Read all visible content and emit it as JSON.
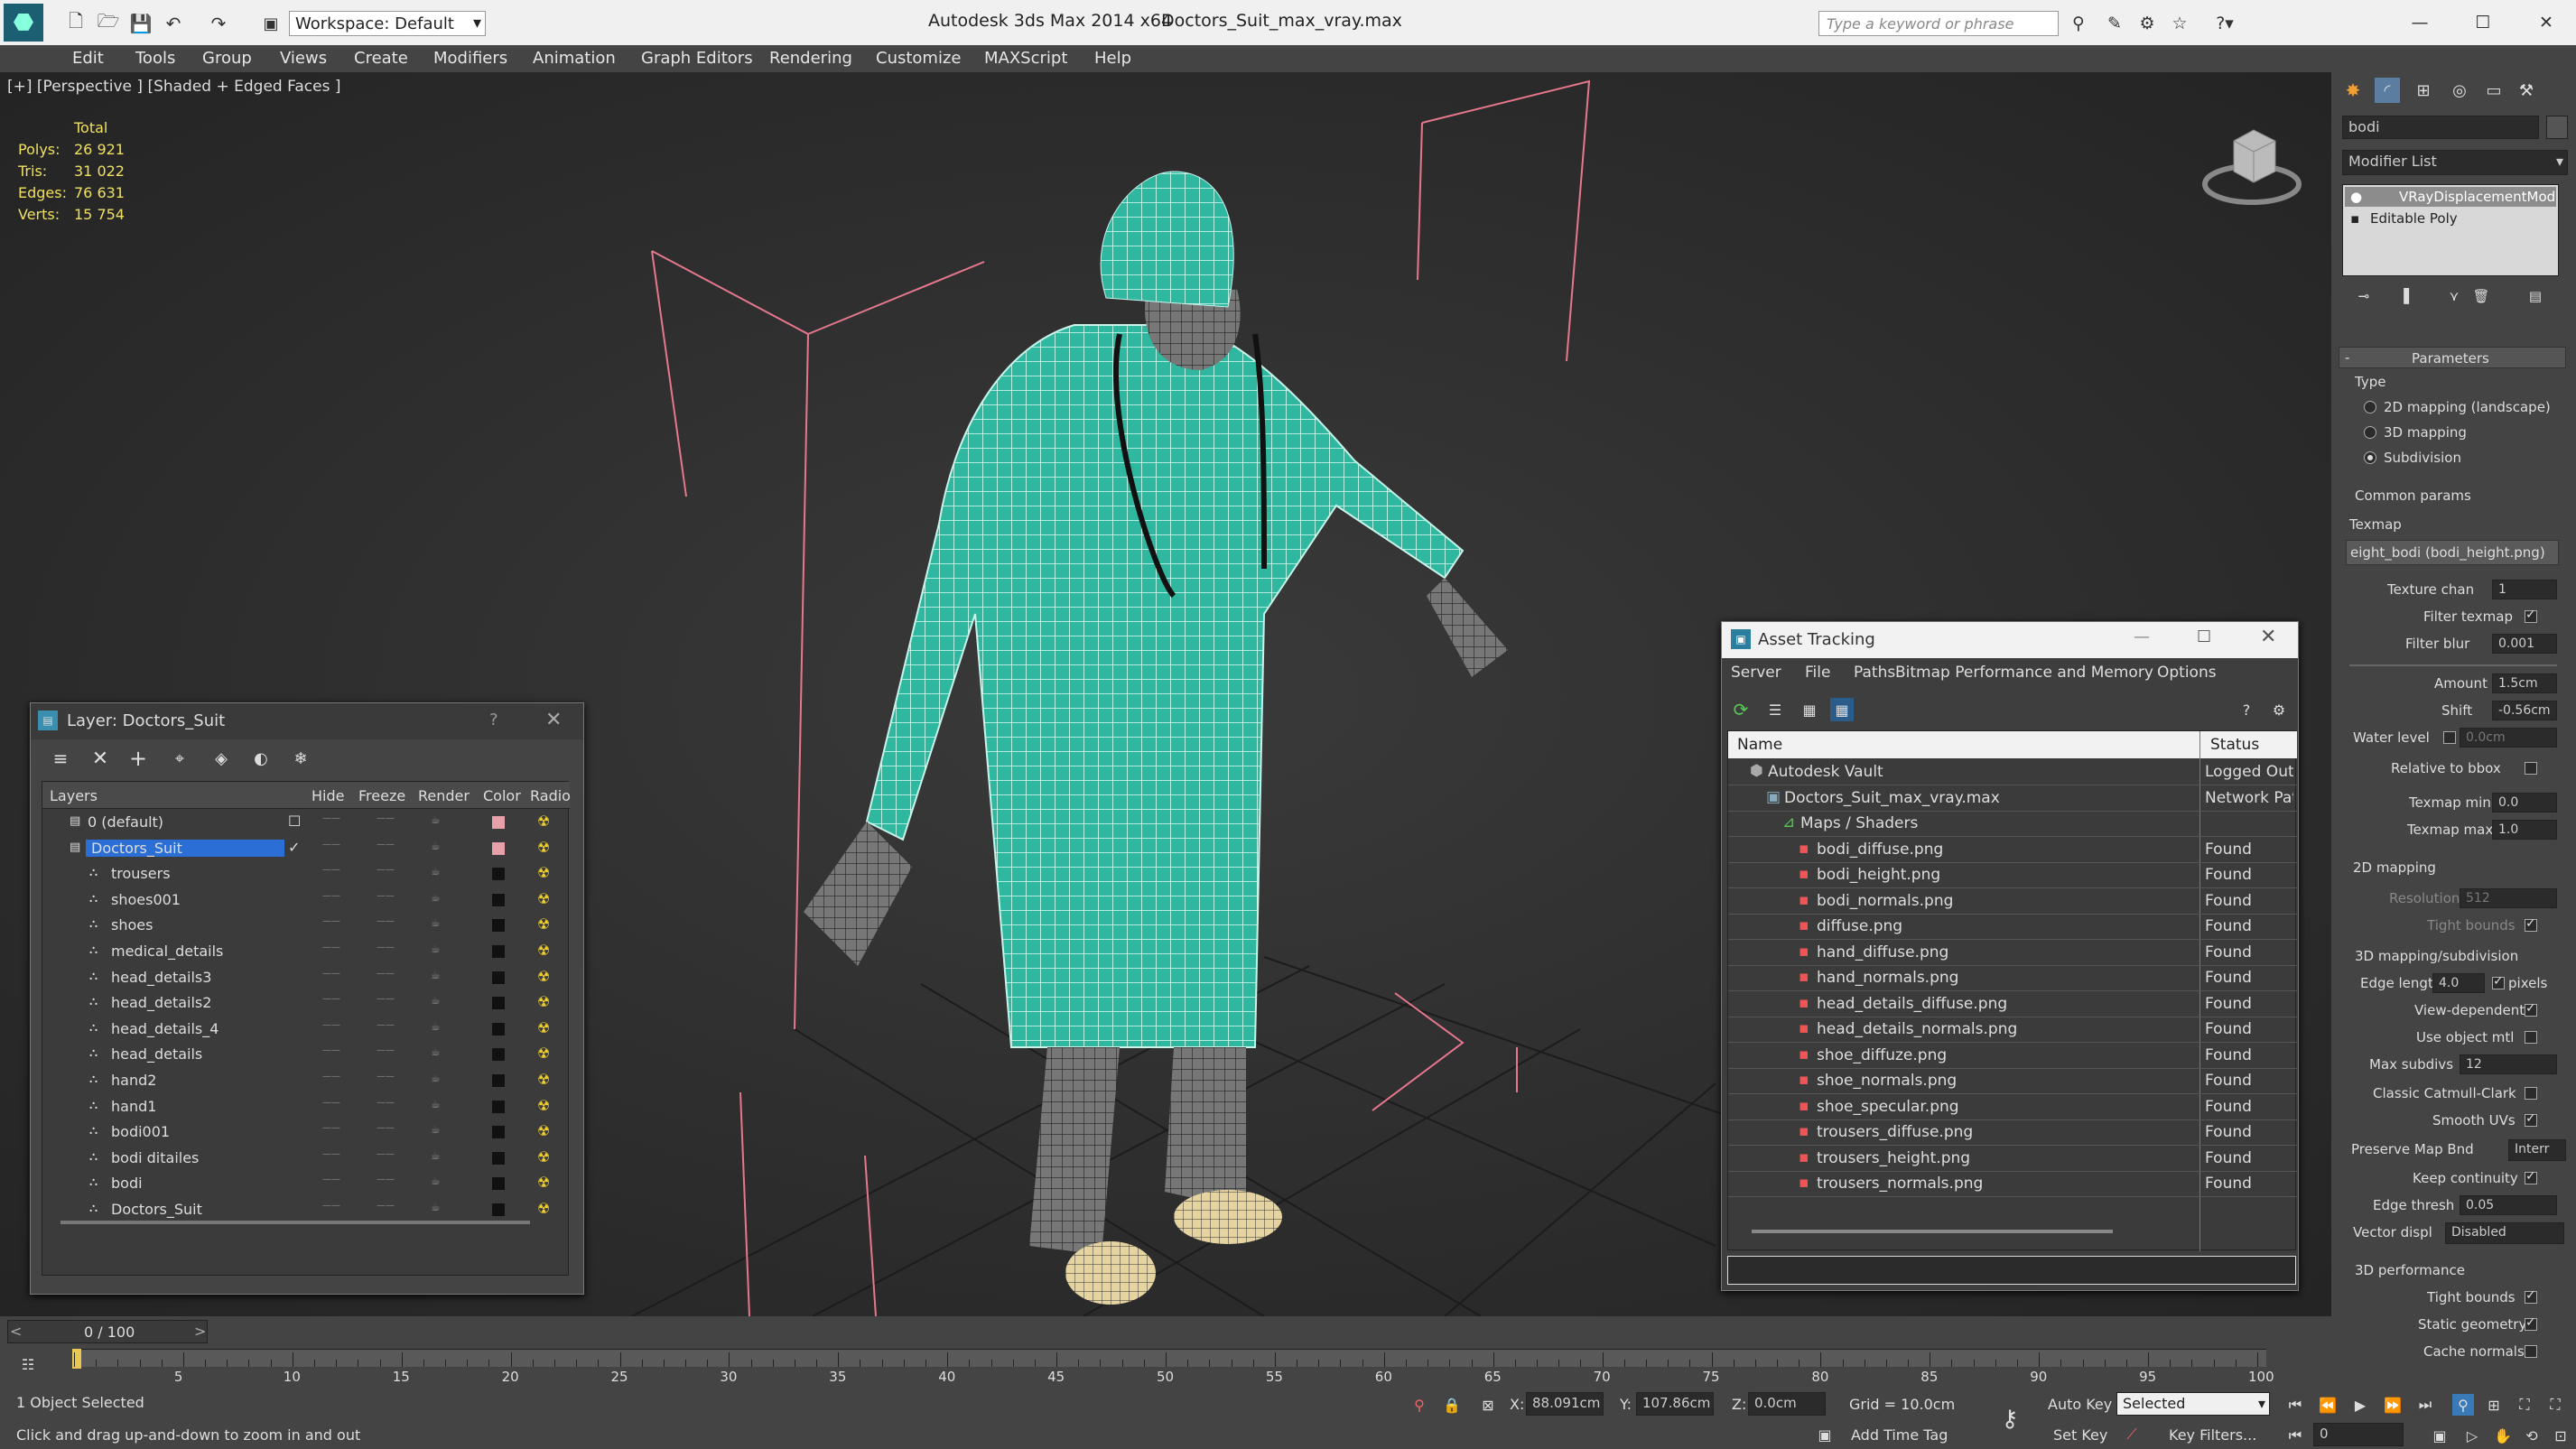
{
  "titlebar": {
    "app": "Autodesk 3ds Max  2014 x64",
    "file": "Doctors_Suit_max_vray.max",
    "workspace": "Workspace: Default",
    "search_placeholder": "Type a keyword or phrase"
  },
  "menu": [
    "Edit",
    "Tools",
    "Group",
    "Views",
    "Create",
    "Modifiers",
    "Animation",
    "Graph Editors",
    "Rendering",
    "Customize",
    "MAXScript",
    "Help"
  ],
  "viewport": {
    "label": "[+] [Perspective ] [Shaded + Edged Faces ]",
    "stats": {
      "header": "Total",
      "rows": [
        {
          "k": "Polys:",
          "v": "26 921"
        },
        {
          "k": "Tris:",
          "v": "31 022"
        },
        {
          "k": "Edges:",
          "v": "76 631"
        },
        {
          "k": "Verts:",
          "v": "15 754"
        }
      ]
    }
  },
  "layer_window": {
    "title": "Layer: Doctors_Suit",
    "columns": [
      "Layers",
      "Hide",
      "Freeze",
      "Render",
      "Color",
      "Radio"
    ],
    "rows": [
      {
        "name": "0 (default)",
        "color": "#e8a0a8",
        "level": 0
      },
      {
        "name": "Doctors_Suit",
        "color": "#e8a0a8",
        "level": 0,
        "selected": true
      },
      {
        "name": "trousers",
        "color": "#111",
        "level": 1
      },
      {
        "name": "shoes001",
        "color": "#111",
        "level": 1
      },
      {
        "name": "shoes",
        "color": "#111",
        "level": 1
      },
      {
        "name": "medical_details",
        "color": "#111",
        "level": 1
      },
      {
        "name": "head_details3",
        "color": "#111",
        "level": 1
      },
      {
        "name": "head_details2",
        "color": "#111",
        "level": 1
      },
      {
        "name": "head_details_4",
        "color": "#111",
        "level": 1
      },
      {
        "name": "head_details",
        "color": "#111",
        "level": 1
      },
      {
        "name": "hand2",
        "color": "#111",
        "level": 1
      },
      {
        "name": "hand1",
        "color": "#111",
        "level": 1
      },
      {
        "name": "bodi001",
        "color": "#111",
        "level": 1
      },
      {
        "name": "bodi ditailes",
        "color": "#111",
        "level": 1
      },
      {
        "name": "bodi",
        "color": "#111",
        "level": 1
      },
      {
        "name": "Doctors_Suit",
        "color": "#111",
        "level": 1
      }
    ]
  },
  "asset_window": {
    "title": "Asset Tracking",
    "menu": [
      "Server",
      "File",
      "Paths",
      "Bitmap Performance and Memory",
      "Options"
    ],
    "columns": [
      "Name",
      "Status"
    ],
    "rows": [
      {
        "name": "Autodesk Vault",
        "status": "Logged Out",
        "level": 0
      },
      {
        "name": "Doctors_Suit_max_vray.max",
        "status": "Network Path",
        "level": 1
      },
      {
        "name": "Maps / Shaders",
        "status": "",
        "level": 2
      },
      {
        "name": "bodi_diffuse.png",
        "status": "Found",
        "level": 3
      },
      {
        "name": "bodi_height.png",
        "status": "Found",
        "level": 3
      },
      {
        "name": "bodi_normals.png",
        "status": "Found",
        "level": 3
      },
      {
        "name": "diffuse.png",
        "status": "Found",
        "level": 3
      },
      {
        "name": "hand_diffuse.png",
        "status": "Found",
        "level": 3
      },
      {
        "name": "hand_normals.png",
        "status": "Found",
        "level": 3
      },
      {
        "name": "head_details_diffuse.png",
        "status": "Found",
        "level": 3
      },
      {
        "name": "head_details_normals.png",
        "status": "Found",
        "level": 3
      },
      {
        "name": "shoe_diffuze.png",
        "status": "Found",
        "level": 3
      },
      {
        "name": "shoe_normals.png",
        "status": "Found",
        "level": 3
      },
      {
        "name": "shoe_specular.png",
        "status": "Found",
        "level": 3
      },
      {
        "name": "trousers_diffuse.png",
        "status": "Found",
        "level": 3
      },
      {
        "name": "trousers_height.png",
        "status": "Found",
        "level": 3
      },
      {
        "name": "trousers_normals.png",
        "status": "Found",
        "level": 3
      }
    ]
  },
  "cmdpanel": {
    "object_name": "bodi",
    "modifier_list": "Modifier List",
    "stack": [
      "VRayDisplacementMod",
      "Editable Poly"
    ],
    "rollout": "Parameters",
    "type_label": "Type",
    "types": [
      {
        "label": "2D mapping (landscape)",
        "on": false
      },
      {
        "label": "3D mapping",
        "on": false
      },
      {
        "label": "Subdivision",
        "on": true
      }
    ],
    "common": "Common params",
    "texmap": "Texmap",
    "texmap_value": "eight_bodi (bodi_height.png)",
    "params": [
      {
        "k": "Texture chan",
        "v": "1"
      },
      {
        "k": "Filter blur",
        "v": "0.001"
      },
      {
        "k": "Amount",
        "v": "1.5cm"
      },
      {
        "k": "Shift",
        "v": "-0.56cm"
      },
      {
        "k": "Water level",
        "v": "0.0cm"
      }
    ],
    "filter_texmap": "Filter texmap",
    "relative": "Relative to bbox",
    "texmap_min": {
      "k": "Texmap min",
      "v": "0.0"
    },
    "texmap_max": {
      "k": "Texmap max",
      "v": "1.0"
    },
    "map2d": "2D mapping",
    "resolution": {
      "k": "Resolution",
      "v": "512"
    },
    "tight_bounds": "Tight bounds",
    "map3d": "3D mapping/subdivision",
    "edge_length": {
      "k": "Edge length",
      "v": "4.0"
    },
    "pixels": "pixels",
    "checks": [
      {
        "label": "View-dependent",
        "on": true
      },
      {
        "label": "Use object mtl",
        "on": false
      }
    ],
    "max_subdivs": {
      "k": "Max subdivs",
      "v": "12"
    },
    "checks2": [
      {
        "label": "Classic Catmull-Clark",
        "on": false
      },
      {
        "label": "Smooth UVs",
        "on": true
      }
    ],
    "preserve": {
      "k": "Preserve Map Bnd",
      "v": "Interr"
    },
    "keep": "Keep continuity",
    "edge_thresh": {
      "k": "Edge thresh",
      "v": "0.05"
    },
    "vector": {
      "k": "Vector displ",
      "v": "Disabled"
    },
    "perf": "3D performance",
    "perf_checks": [
      {
        "label": "Tight bounds",
        "on": true
      },
      {
        "label": "Static geometry",
        "on": true
      },
      {
        "label": "Cache normals",
        "on": false
      }
    ]
  },
  "timeline": {
    "frame": "0 / 100",
    "ticks": [
      "5",
      "10",
      "15",
      "20",
      "25",
      "30",
      "35",
      "40",
      "45",
      "50",
      "55",
      "60",
      "65",
      "70",
      "75",
      "80",
      "85",
      "90",
      "95",
      "100"
    ]
  },
  "status": {
    "selected": "1 Object Selected",
    "hint": "Click and drag up-and-down to zoom in and out",
    "x_label": "X:",
    "x": "88.091cm",
    "y_label": "Y:",
    "y": "107.86cm",
    "z_label": "Z:",
    "z": "0.0cm",
    "grid": "Grid = 10.0cm",
    "add_time_tag": "Add Time Tag",
    "auto_key": "Auto Key",
    "set_key": "Set Key",
    "selected_dd": "Selected",
    "key_filters": "Key Filters...",
    "frame_field": "0"
  }
}
